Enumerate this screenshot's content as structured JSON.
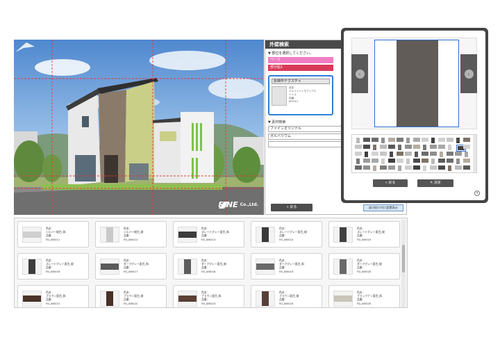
{
  "panel": {
    "title": "外壁検索",
    "select_label": "▼ 部位を選択してください。",
    "part_base": "ベース",
    "part_accent": "部分貼1",
    "reflect_title": "反映中テクスチャ",
    "reflect_lines": [
      "品名：",
      "エルファインモアリアル",
      "ツイル",
      "品番：",
      "EFP021"
    ],
    "search_label": "▼ 素材検索",
    "material_1": "ファインオリジナル",
    "material_2": "ガルバリウム",
    "material_3": "",
    "back_label": "戻る",
    "show_all_label": "部分貼り付け設置表示"
  },
  "popup": {
    "back_label": "戻る",
    "decide_label": "決定",
    "prev_icon": "chevron-left-icon",
    "next_icon": "chevron-right-icon",
    "close_icon": "close-icon"
  },
  "catalog": {
    "name_label": "色名：",
    "code_label": "品番：",
    "items": [
      {
        "name": "シルバー縦目_斜",
        "code": "FD_W0011",
        "color": "#cfcfcf",
        "style": "horizontal"
      },
      {
        "name": "シルバー縦目_縦",
        "code": "FD_W0012",
        "color": "#c9c9c9",
        "style": "vertical"
      },
      {
        "name": "スレートグレー亜目_斜",
        "code": "FD_W0013",
        "color": "#3c3c3c",
        "style": "horizontal"
      },
      {
        "name": "スレートグレー亜目_縦",
        "code": "FD_W0014",
        "color": "#3a3a3a",
        "style": "vertical"
      },
      {
        "name": "スレートグレー亜目_縦",
        "code": "FD_W0015",
        "color": "#404040",
        "style": "vertical"
      },
      {
        "name": "スレートグレー亜目_縦",
        "code": "FD_W0016",
        "color": "#3d3d3d",
        "style": "vertical"
      },
      {
        "name": "ダークグレー亜目_斜",
        "code": "FD_W0017",
        "color": "#5a5a5a",
        "style": "horizontal"
      },
      {
        "name": "ダークグレー亜目_縦",
        "code": "FD_W0018",
        "color": "#5c5c5c",
        "style": "vertical"
      },
      {
        "name": "ダークグレー亜目_斜",
        "code": "FD_W0019",
        "color": "#6a6a6a",
        "style": "horizontal"
      },
      {
        "name": "ダークグレー亜目_縦",
        "code": "FD_W0020",
        "color": "#696969",
        "style": "vertical"
      },
      {
        "name": "ブラウン亜目_斜",
        "code": "FD_W0021",
        "color": "#4a3329",
        "style": "horizontal"
      },
      {
        "name": "ブラウン亜目_縦",
        "code": "FD_W0022",
        "color": "#472f26",
        "style": "vertical"
      },
      {
        "name": "ブラウン亜目_斜",
        "code": "FD_W0023",
        "color": "#5b4035",
        "style": "horizontal"
      },
      {
        "name": "ブラウン亜目_縦",
        "code": "FD_W0024",
        "color": "#57403a",
        "style": "vertical"
      },
      {
        "name": "ブラックナン亜目_斜",
        "code": "FD_W0025",
        "color": "#c8c4b9",
        "style": "horizontal"
      }
    ]
  },
  "colors": {
    "accent_blue": "#2d7fd6",
    "pink": "#f07ec2",
    "red": "#d83a58",
    "dark_button": "#4d4d4d"
  }
}
